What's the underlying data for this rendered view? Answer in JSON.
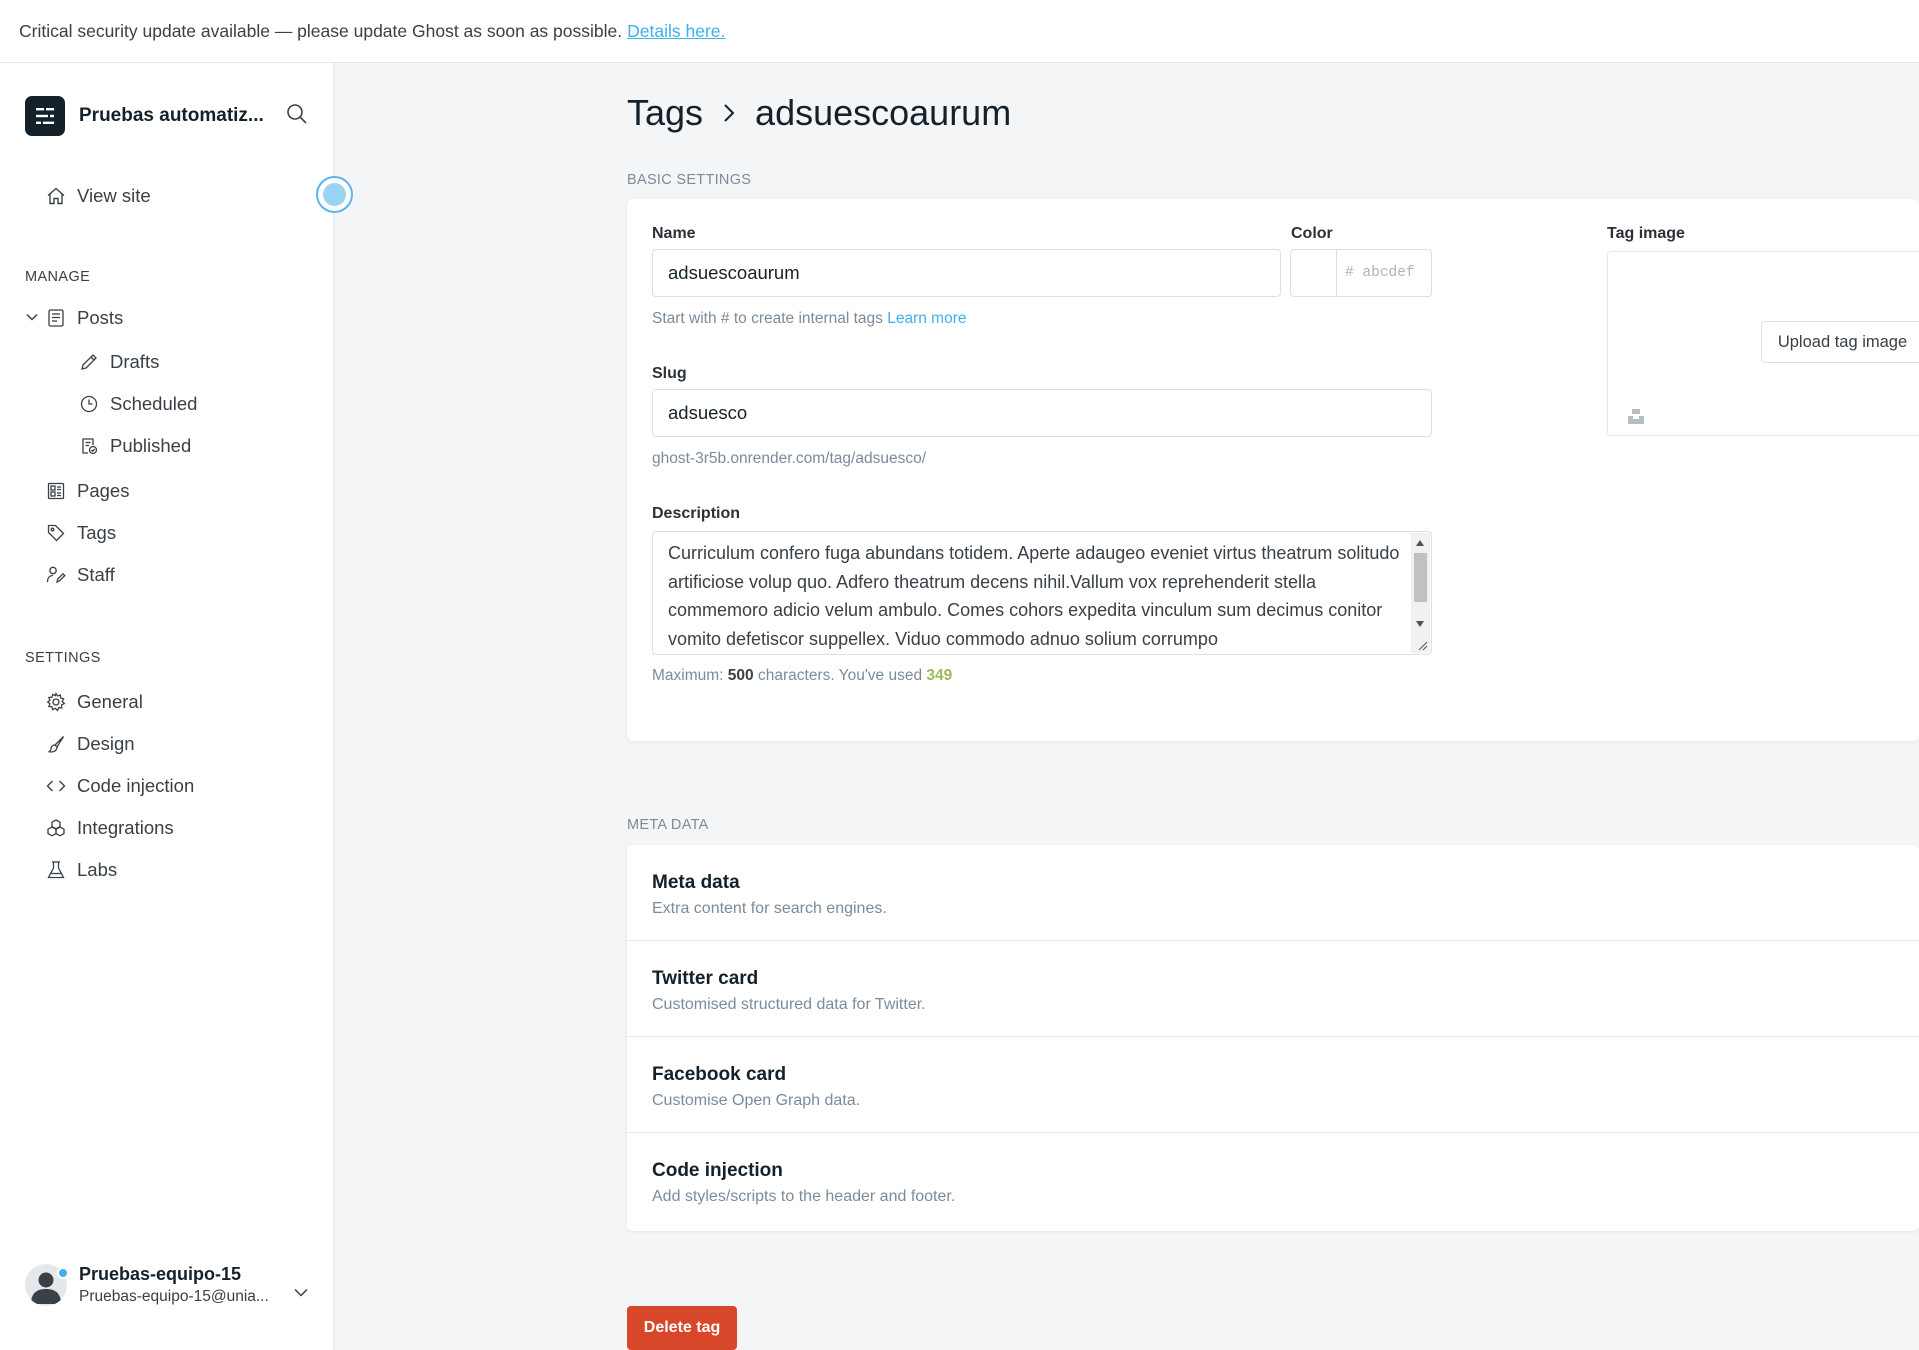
{
  "banner": {
    "message": "Critical security update available — please update Ghost as soon as possible.",
    "link_label": "Details here."
  },
  "sidebar": {
    "site_title": "Pruebas automatiz...",
    "view_site_label": "View site",
    "manage_heading": "MANAGE",
    "settings_heading": "SETTINGS",
    "posts_label": "Posts",
    "drafts_label": "Drafts",
    "scheduled_label": "Scheduled",
    "published_label": "Published",
    "pages_label": "Pages",
    "tags_label": "Tags",
    "staff_label": "Staff",
    "general_label": "General",
    "design_label": "Design",
    "code_injection_label": "Code injection",
    "integrations_label": "Integrations",
    "labs_label": "Labs",
    "user_name": "Pruebas-equipo-15",
    "user_email": "Pruebas-equipo-15@unia..."
  },
  "header": {
    "crumb_parent": "Tags",
    "crumb_current": "adsuescoaurum"
  },
  "basic": {
    "section_label": "BASIC SETTINGS",
    "name_label": "Name",
    "name_value": "adsuescoaurum",
    "name_hint": "Start with # to create internal tags",
    "learn_more": "Learn more",
    "color_label": "Color",
    "color_placeholder": "# abcdef",
    "slug_label": "Slug",
    "slug_value": "adsuesco",
    "slug_url": "ghost-3r5b.onrender.com/tag/adsuesco/",
    "description_label": "Description",
    "description_value": "Curriculum confero fuga abundans totidem. Aperte adaugeo eveniet virtus theatrum solitudo artificiose volup quo. Adfero theatrum decens nihil.Vallum vox reprehenderit stella commemoro adicio velum ambulo. Comes cohors expedita vinculum sum decimus conitor vomito defetiscor suppellex. Viduo commodo adnuo solium corrumpo",
    "count_prefix": "Maximum:",
    "count_max": "500",
    "count_middle": "characters. You've used",
    "count_used": "349",
    "tag_image_label": "Tag image",
    "upload_label": "Upload tag image"
  },
  "meta": {
    "section_label": "META DATA",
    "rows": [
      {
        "title": "Meta data",
        "desc": "Extra content for search engines."
      },
      {
        "title": "Twitter card",
        "desc": "Customised structured data for Twitter."
      },
      {
        "title": "Facebook card",
        "desc": "Customise Open Graph data."
      },
      {
        "title": "Code injection",
        "desc": "Add styles/scripts to the header and footer."
      }
    ]
  },
  "actions": {
    "delete_label": "Delete tag",
    "delete_color": "#d9472b"
  },
  "colors": {
    "accent_blue": "#3eb0ef",
    "count_green": "#9fbb58"
  }
}
